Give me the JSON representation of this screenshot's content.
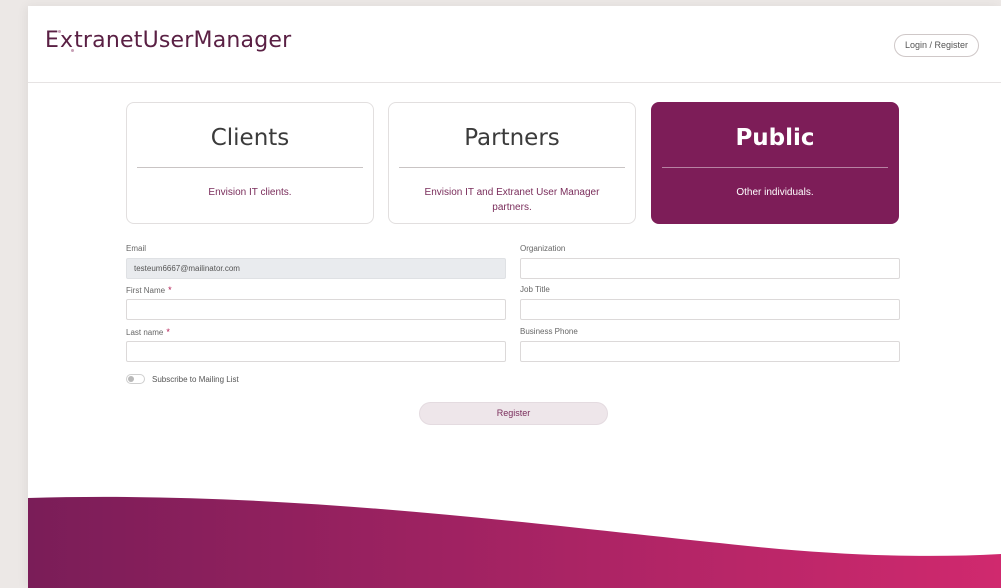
{
  "header": {
    "logo_prefix": "E",
    "logo_x": "x",
    "logo_rest": "tranetUserManager",
    "login_label": "Login / Register"
  },
  "cards": [
    {
      "title": "Clients",
      "description": "Envision IT clients."
    },
    {
      "title": "Partners",
      "description": "Envision IT and Extranet User Manager partners."
    },
    {
      "title": "Public",
      "description": "Other individuals."
    }
  ],
  "form": {
    "email": {
      "label": "Email",
      "value": "testeum6667@mailinator.com"
    },
    "organization": {
      "label": "Organization",
      "value": ""
    },
    "first_name": {
      "label": "First Name",
      "required_marker": "*",
      "value": ""
    },
    "job_title": {
      "label": "Job Title",
      "value": ""
    },
    "last_name": {
      "label": "Last name",
      "required_marker": "*",
      "value": ""
    },
    "business_phone": {
      "label": "Business Phone",
      "value": ""
    },
    "subscribe": {
      "label": "Subscribe to Mailing List",
      "checked": false
    },
    "register_label": "Register"
  },
  "colors": {
    "brand": "#7d1d58",
    "brand_accent": "#c7246a",
    "required": "#b0154e"
  },
  "icons": {
    "toggle": "toggle-switch-icon"
  }
}
